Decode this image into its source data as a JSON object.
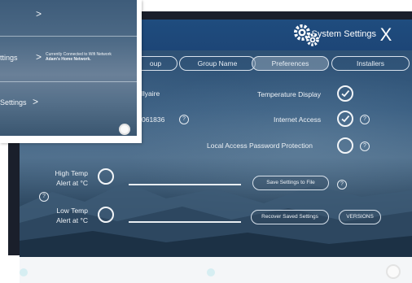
{
  "header": {
    "title": "System Settings",
    "close_symbol": "X"
  },
  "tabs": [
    {
      "label": "oup",
      "active": false
    },
    {
      "label": "Group Name",
      "active": false
    },
    {
      "label": "Preferences",
      "active": true
    },
    {
      "label": "Installers",
      "active": false
    }
  ],
  "info": {
    "name_partial": "llyaire",
    "id_partial": "061836"
  },
  "prefs": {
    "temp_display": {
      "label": "Temperature Display",
      "checked": true
    },
    "internet": {
      "label": "Internet Access",
      "checked": true
    },
    "local_pw": {
      "label": "Local Access Password Protection",
      "checked": false
    }
  },
  "alerts": {
    "high": {
      "label_line1": "High Temp",
      "label_line2": "Alert at °C"
    },
    "low": {
      "label_line1": "Low Temp",
      "label_line2": "Alert at °C"
    }
  },
  "buttons": {
    "save_file": "Save Settings to File",
    "recover": "Recover Saved Settings",
    "versions": "VERSIONS"
  },
  "help_symbol": "?",
  "overlay": {
    "rows": [
      {
        "label": ""
      },
      {
        "label": "ttings",
        "status_line1": "Currently Connected to Wifi Network",
        "status_line2": "Adam's Home Network."
      },
      {
        "label": "Settings"
      }
    ],
    "chevron": ">"
  },
  "colors": {
    "header": "#1d4677",
    "accent_text": "#eef2f6",
    "frame": "#1a1f2b"
  }
}
